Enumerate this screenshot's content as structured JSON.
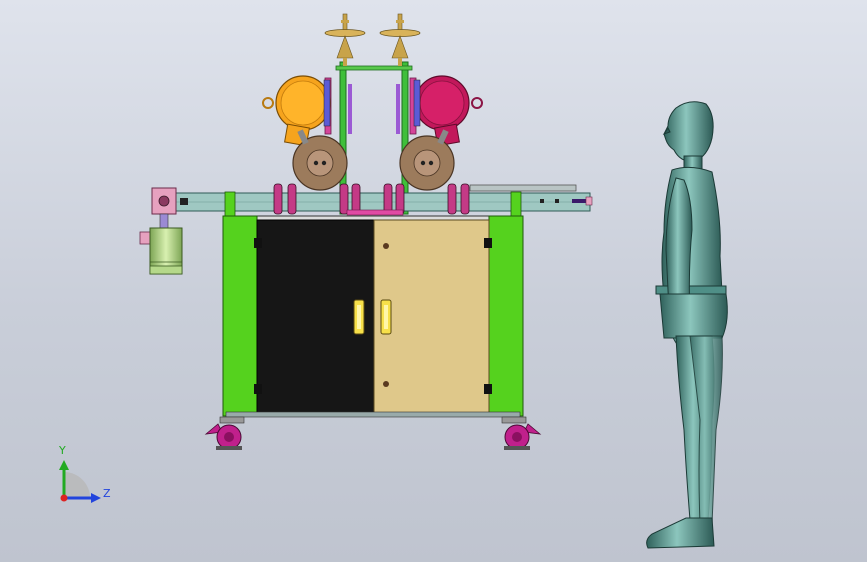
{
  "viewport": {
    "background_top": "#dfe3ec",
    "background_bottom": "#bfc4cf"
  },
  "colors": {
    "frame_green": "#55d21e",
    "cabinet_black": "#161616",
    "door_tan": "#dfc88a",
    "conveyor_teal": "#9fc8c2",
    "reel_orange": "#f6a41d",
    "reel_magenta": "#c2185b",
    "roller_brown": "#9c7b5c",
    "caster_magenta": "#c0208c",
    "motor_green": "#a8cc7a",
    "figure_teal": "#5f9b93",
    "axis_y": "#22aa22",
    "axis_z": "#2244dd",
    "axis_origin": "#dd2222"
  },
  "triad": {
    "y_label": "Y",
    "z_label": "Z"
  },
  "icons": [
    "coordinate-triad-icon"
  ]
}
